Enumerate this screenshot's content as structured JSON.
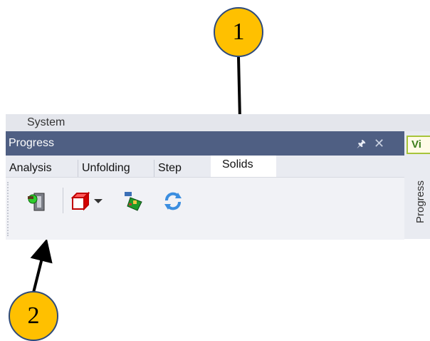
{
  "callouts": [
    {
      "label": "1"
    },
    {
      "label": "2"
    }
  ],
  "system": {
    "label": "System"
  },
  "window": {
    "title": "Progress",
    "pin_icon": "pin-icon",
    "close_icon": "close-icon",
    "side_tab_label": "Vi",
    "side_vertical_label": "Progress"
  },
  "tabs": [
    {
      "label": "Analysis",
      "selected": false
    },
    {
      "label": "Unfolding",
      "selected": false
    },
    {
      "label": "Step",
      "selected": false
    },
    {
      "label": "Solids",
      "selected": true
    }
  ],
  "toolbar": {
    "buttons": [
      {
        "icon": "solid-tree-icon"
      },
      {
        "icon": "red-cube-dropdown-icon"
      },
      {
        "icon": "pcb-part-icon"
      },
      {
        "icon": "refresh-icon"
      }
    ]
  },
  "colors": {
    "titlebar": "#4f5f83",
    "callout_fill": "#FFC000",
    "callout_border": "#2e4a7a"
  }
}
